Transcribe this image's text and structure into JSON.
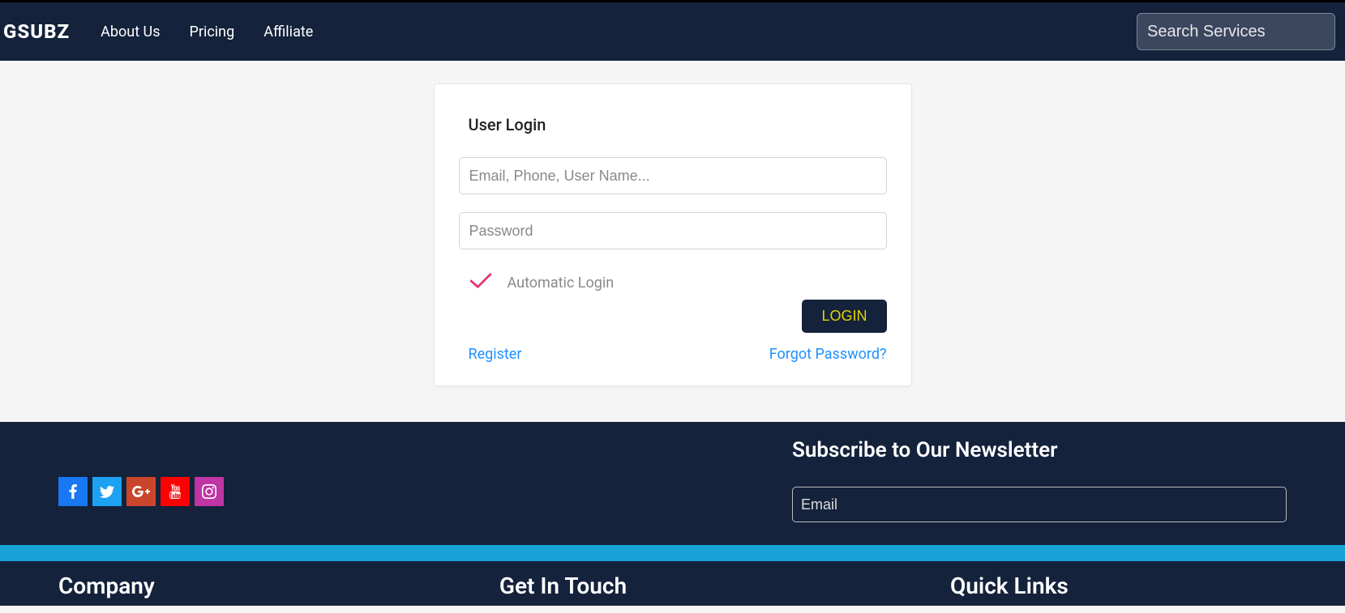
{
  "nav": {
    "brand": "GSUBZ",
    "links": [
      "About Us",
      "Pricing",
      "Affiliate"
    ],
    "search_placeholder": "Search Services"
  },
  "login": {
    "title": "User Login",
    "username_placeholder": "Email, Phone, User Name...",
    "password_placeholder": "Password",
    "auto_login_label": "Automatic Login",
    "login_button": "LOGIN",
    "register_link": "Register",
    "forgot_link": "Forgot Password?"
  },
  "footer": {
    "newsletter_title": "Subscribe to Our Newsletter",
    "newsletter_placeholder": "Email",
    "company_heading": "Company",
    "get_in_touch_heading": "Get In Touch",
    "quick_links_heading": "Quick Links",
    "social": {
      "facebook": "facebook-icon",
      "twitter": "twitter-icon",
      "googleplus": "googleplus-icon",
      "youtube": "youtube-icon",
      "instagram": "instagram-icon"
    }
  }
}
